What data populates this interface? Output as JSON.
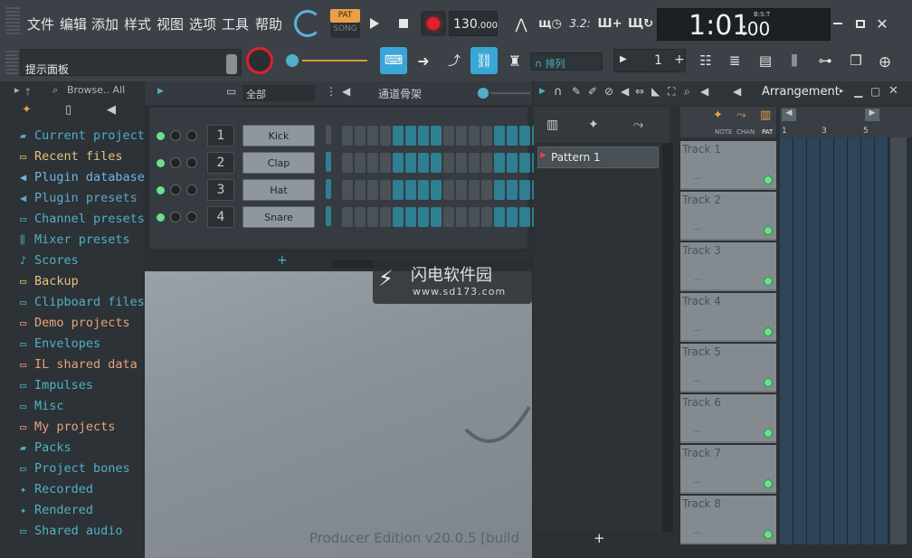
{
  "menu": [
    "文件",
    "编辑",
    "添加",
    "样式",
    "视图",
    "选项",
    "工具",
    "帮助"
  ],
  "transport": {
    "pat_label": "PAT",
    "song_label": "SONG",
    "tempo": "130",
    "tempo_frac": ".000",
    "time_main": "1:01",
    "time_sub": ":00",
    "time_label": "B:S:T",
    "play_icon": "play-icon",
    "stop_icon": "stop-icon",
    "record_icon": "record-icon"
  },
  "toolbar": {
    "hint": "提示面板",
    "snap_label": "排列",
    "step_value": "1",
    "step_plus": "+",
    "pattern_counter": "3.2:"
  },
  "browser": {
    "header": "Browse.. All",
    "items": [
      {
        "label": "Current project",
        "color": "#4fb0c6"
      },
      {
        "label": "Recent files",
        "color": "#e6c27a"
      },
      {
        "label": "Plugin database",
        "color": "#6bb7e8"
      },
      {
        "label": "Plugin presets",
        "color": "#5ea8c8"
      },
      {
        "label": "Channel presets",
        "color": "#4fb0c6"
      },
      {
        "label": "Mixer presets",
        "color": "#4fb0c6"
      },
      {
        "label": "Scores",
        "color": "#4fb0c6"
      },
      {
        "label": "Backup",
        "color": "#e6c27a"
      },
      {
        "label": "Clipboard files",
        "color": "#4fb0c6"
      },
      {
        "label": "Demo projects",
        "color": "#e8a27a"
      },
      {
        "label": "Envelopes",
        "color": "#4fb0c6"
      },
      {
        "label": "IL shared data",
        "color": "#e8a27a"
      },
      {
        "label": "Impulses",
        "color": "#4fb0c6"
      },
      {
        "label": "Misc",
        "color": "#4fb0c6"
      },
      {
        "label": "My projects",
        "color": "#e8a27a"
      },
      {
        "label": "Packs",
        "color": "#4fb0c6"
      },
      {
        "label": "Project bones",
        "color": "#4fb0c6"
      },
      {
        "label": "Recorded",
        "color": "#4fb0c6"
      },
      {
        "label": "Rendered",
        "color": "#4fb0c6"
      },
      {
        "label": "Shared audio",
        "color": "#4fb0c6"
      }
    ]
  },
  "channel_rack": {
    "filter": "全部",
    "title": "通道骨架",
    "add_label": "+",
    "channels": [
      {
        "num": "1",
        "name": "Kick"
      },
      {
        "num": "2",
        "name": "Clap"
      },
      {
        "num": "3",
        "name": "Hat"
      },
      {
        "num": "4",
        "name": "Snare"
      }
    ]
  },
  "watermark": {
    "brand": "闪电软件园",
    "site": "www.sd173.com",
    "repeat": "闪电软件园"
  },
  "edition": "Producer Edition v20.0.5 [build",
  "playlist": {
    "title": "Arrangement",
    "tabs": [
      "NOTE",
      "CHAN",
      "PAT"
    ],
    "patterns": [
      "Pattern 1"
    ],
    "add_label": "+",
    "bar_numbers": [
      "1",
      "3",
      "5"
    ],
    "tracks": [
      "Track 1",
      "Track 2",
      "Track 3",
      "Track 4",
      "Track 5",
      "Track 6",
      "Track 7",
      "Track 8"
    ],
    "track_dots": "..."
  },
  "colors": {
    "accent": "#4fb0c6",
    "record": "#e0202a",
    "step_on": "#2f7f93",
    "step_off": "#4a5157"
  }
}
